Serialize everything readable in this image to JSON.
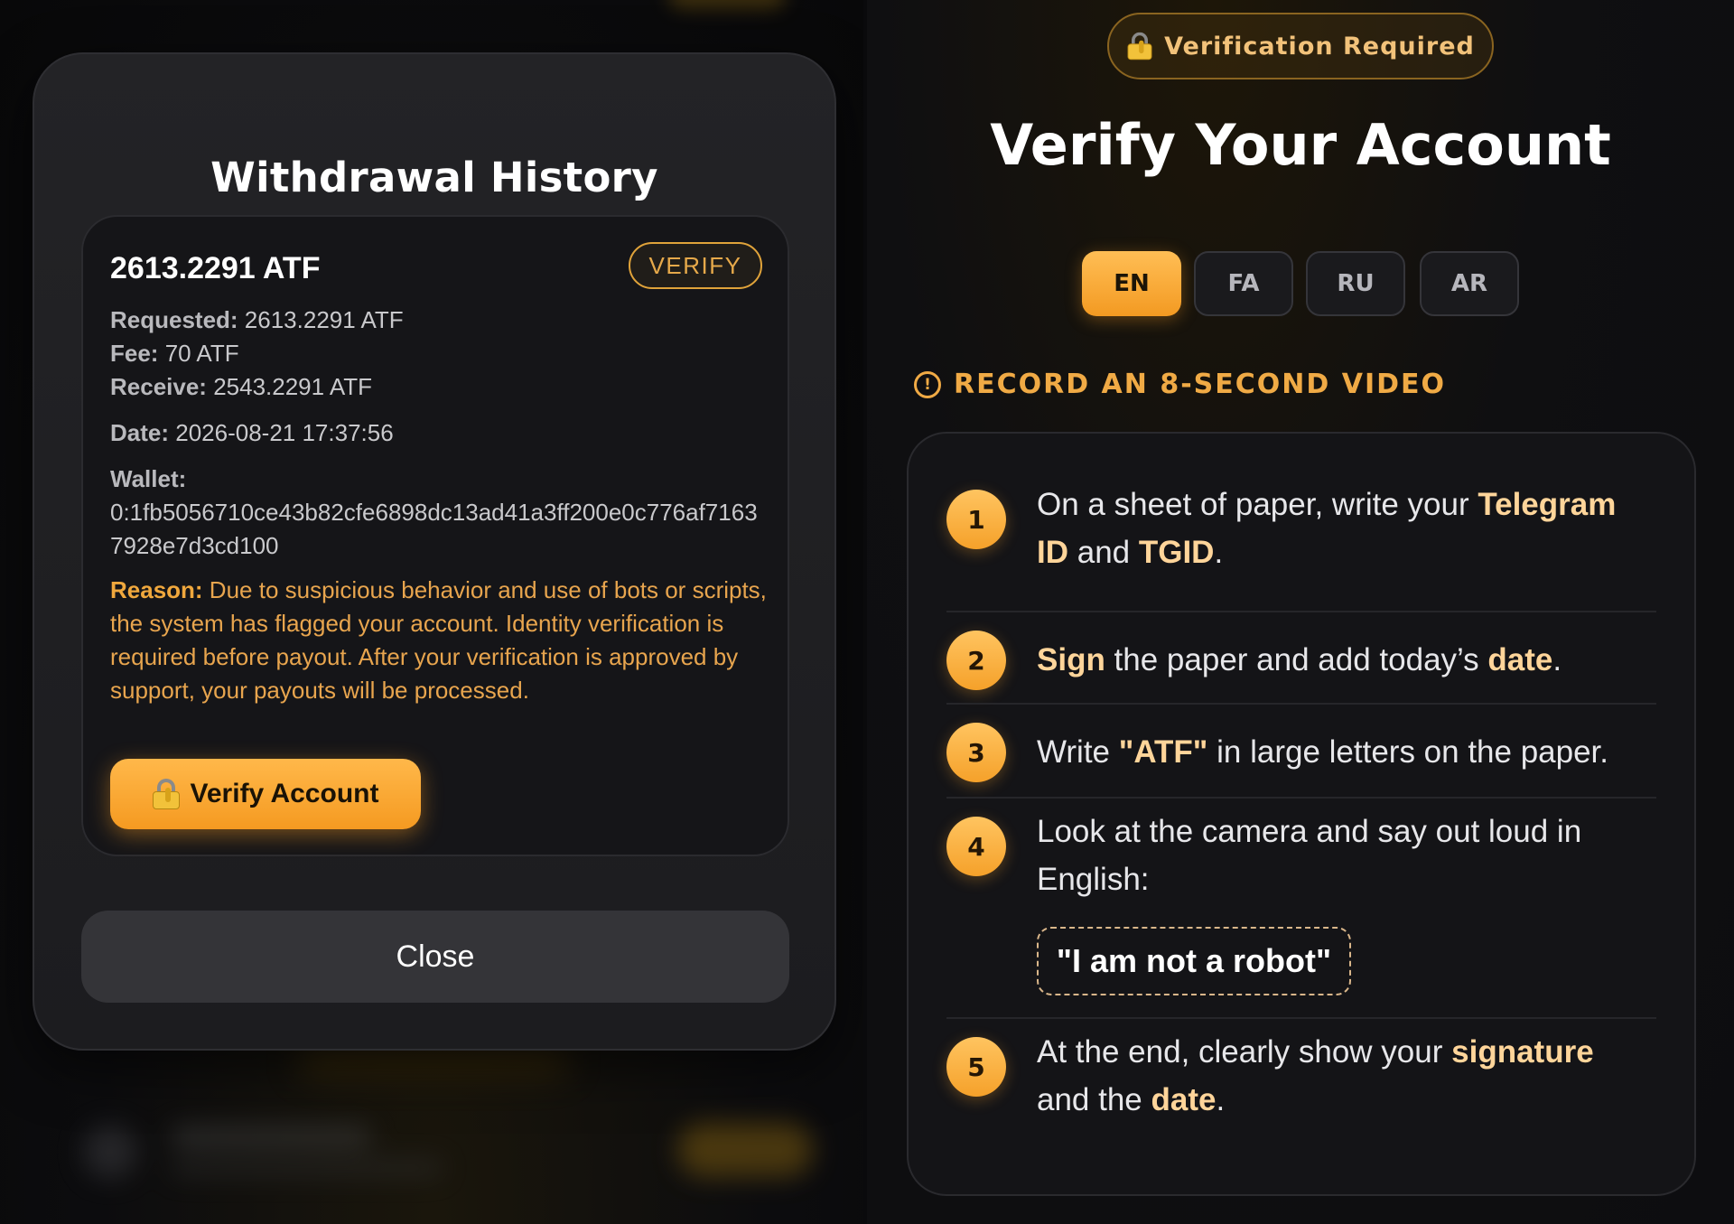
{
  "withdrawal_modal": {
    "title": "Withdrawal History",
    "card": {
      "amount": "2613.2291 ATF",
      "status_badge": "VERIFY",
      "requested_label": "Requested:",
      "requested_value": " 2613.2291 ATF",
      "fee_label": "Fee:",
      "fee_value": " 70 ATF",
      "receive_label": "Receive:",
      "receive_value": " 2543.2291 ATF",
      "date_label": "Date:",
      "date_value": " 2026-08-21 17:37:56",
      "wallet_label": "Wallet:",
      "wallet_value": "0:1fb5056710ce43b82cfe6898dc13ad41a3ff200e0c776af71637928e7d3cd100",
      "reason_label": "Reason:",
      "reason_text": " Due to suspicious behavior and use of bots or scripts, the system has flagged your account. Identity verification is required before payout. After your verification is approved by support, your payouts will be processed.",
      "verify_button_label": "Verify Account"
    },
    "close_label": "Close"
  },
  "verification_panel": {
    "badge_label": "Verification Required",
    "title": "Verify Your Account",
    "languages": [
      {
        "code": "EN",
        "active": true
      },
      {
        "code": "FA",
        "active": false
      },
      {
        "code": "RU",
        "active": false
      },
      {
        "code": "AR",
        "active": false
      }
    ],
    "section_heading": "RECORD AN 8-SECOND VIDEO",
    "section_icon_glyph": "!",
    "steps": [
      {
        "number": "1",
        "parts": [
          "On a sheet of paper, write your ",
          "Telegram ID",
          " and ",
          "TGID",
          "."
        ]
      },
      {
        "number": "2",
        "parts": [
          "",
          "Sign",
          " the paper and add today’s ",
          "date",
          "."
        ]
      },
      {
        "number": "3",
        "parts": [
          "Write ",
          "\"ATF\"",
          " in large letters on the paper."
        ]
      },
      {
        "number": "4",
        "text": "Look at the camera and say out loud in English:",
        "quote": "\"I am not a robot\""
      },
      {
        "number": "5",
        "parts": [
          "At the end, clearly show your ",
          "signature",
          " and the ",
          "date",
          "."
        ]
      }
    ]
  },
  "colors": {
    "accent": "#f5a12a",
    "accent_text": "#f0aa45",
    "reason_text": "#e8a54e",
    "modal_bg": "#1f1f22",
    "card_bg": "#151518"
  },
  "icons": [
    "lock-key-icon",
    "info-circle-icon"
  ]
}
